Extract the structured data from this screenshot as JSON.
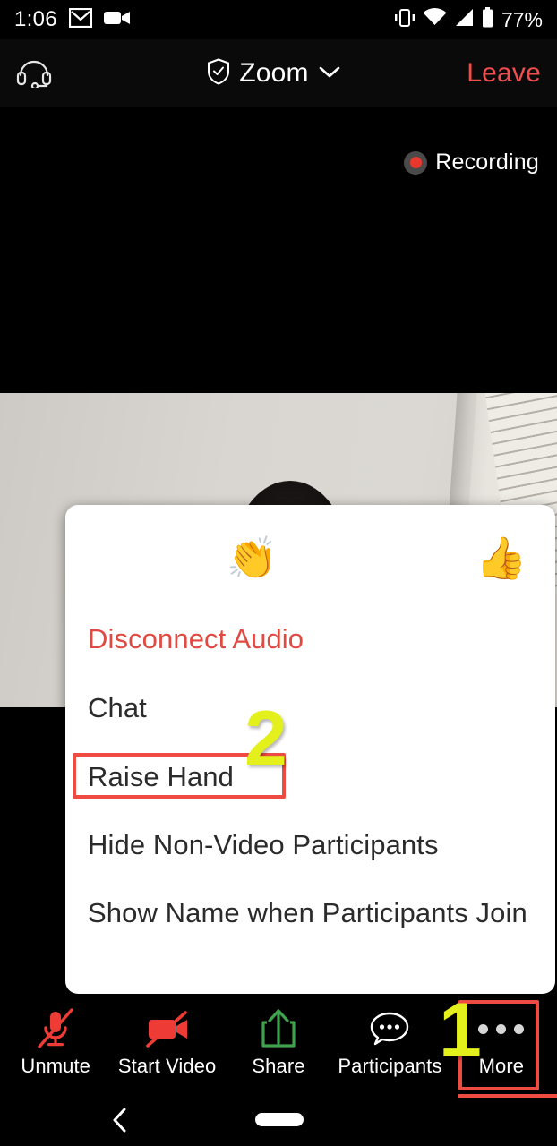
{
  "status_bar": {
    "time": "1:06",
    "battery_percent": "77%",
    "icons": [
      "gmail-icon",
      "video-camera-icon",
      "vibrate-icon",
      "wifi-icon",
      "cellular-signal-icon",
      "battery-icon"
    ]
  },
  "header": {
    "left_icon": "headset-icon",
    "shield_icon": "shield-check-icon",
    "title": "Zoom",
    "chevron_icon": "chevron-down-icon",
    "leave_label": "Leave"
  },
  "stage": {
    "recording_label": "Recording",
    "recording_dot_color": "#e8372c"
  },
  "popup": {
    "reactions": [
      {
        "name": "clap-reaction",
        "glyph": "👏"
      },
      {
        "name": "thumbs-up-reaction",
        "glyph": "👍"
      }
    ],
    "items": [
      {
        "label": "Disconnect Audio",
        "style": "danger"
      },
      {
        "label": "Chat",
        "style": "normal"
      },
      {
        "label": "Raise Hand",
        "style": "normal"
      },
      {
        "label": "Hide Non-Video Participants",
        "style": "normal"
      },
      {
        "label": "Show Name when Participants Join",
        "style": "normal"
      }
    ]
  },
  "toolbar": {
    "items": [
      {
        "label": "Unmute",
        "icon": "microphone-muted-icon",
        "color": "#ef3b36"
      },
      {
        "label": "Start Video",
        "icon": "video-camera-off-icon",
        "color": "#ef3b36"
      },
      {
        "label": "Share",
        "icon": "share-upload-icon",
        "color": "#3fa34d"
      },
      {
        "label": "Participants",
        "icon": "chat-bubble-dots-icon",
        "color": "#ffffff"
      },
      {
        "label": "More",
        "icon": "more-dots-icon",
        "color": "#d6d6d6"
      }
    ]
  },
  "navbar": {
    "back_icon": "back-chevron-icon",
    "home_indicator": "home-pill-indicator"
  },
  "annotations": {
    "step_one": "1",
    "step_two": "2",
    "highlight_color": "#ee4b42",
    "number_color": "#e3f01c"
  }
}
